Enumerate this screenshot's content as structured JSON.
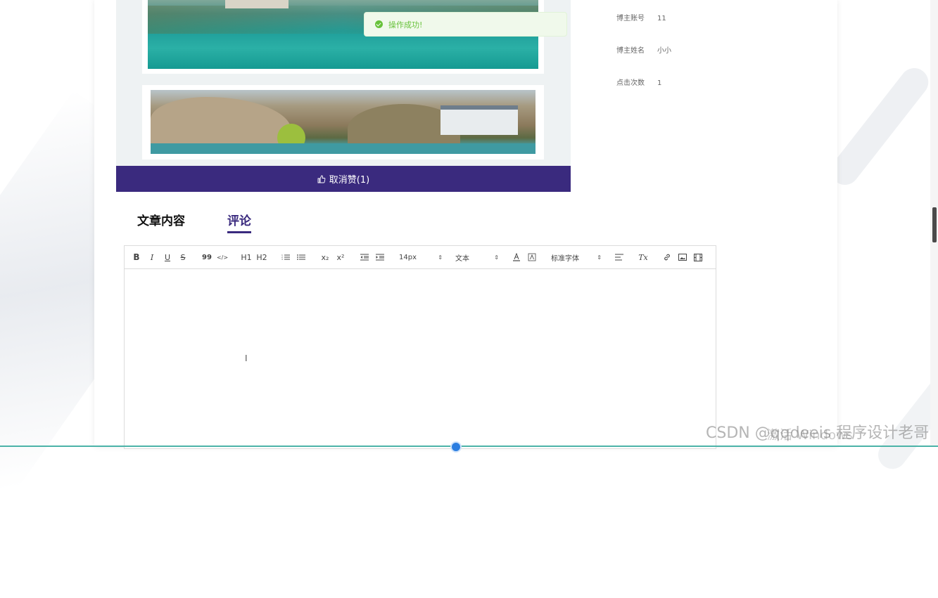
{
  "toast": {
    "message": "操作成功!"
  },
  "like_button": {
    "label": "取消赞(1)"
  },
  "blogger_info": [
    {
      "key": "博主账号",
      "value": "11"
    },
    {
      "key": "博主姓名",
      "value": "小小"
    },
    {
      "key": "点击次数",
      "value": "1"
    }
  ],
  "tabs": [
    {
      "label": "文章内容",
      "active": false
    },
    {
      "label": "评论",
      "active": true
    }
  ],
  "toolbar": {
    "bold": "B",
    "italic": "I",
    "underline": "U",
    "strike": "S",
    "blockquote": "99",
    "code": "</>",
    "h1": "H1",
    "h2": "H2",
    "subscript": "x₂",
    "superscript": "x²",
    "font_size": "14px",
    "header_select": "文本",
    "font_family": "标准字体",
    "clean": "Tx"
  },
  "watermarks": {
    "csdn": "CSDN @qqdeeis 程序设计老哥",
    "windows": "激活 Windows"
  },
  "colors": {
    "accent": "#3a2a7e",
    "success": "#67c23a"
  }
}
